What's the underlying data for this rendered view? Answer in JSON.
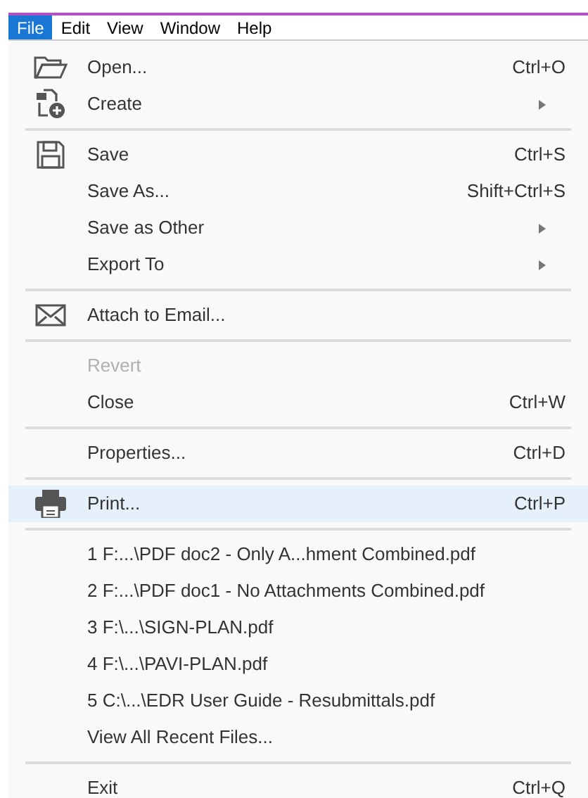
{
  "menu_bar": [
    {
      "label": "File",
      "selected": true
    },
    {
      "label": "Edit",
      "selected": false
    },
    {
      "label": "View",
      "selected": false
    },
    {
      "label": "Window",
      "selected": false
    },
    {
      "label": "Help",
      "selected": false
    }
  ],
  "menu": [
    {
      "kind": "folder",
      "label": "Open...",
      "shortcut": "Ctrl+O",
      "submenu": false,
      "disabled": false,
      "highlighted": false
    },
    {
      "kind": "create",
      "label": "Create",
      "submenu": true,
      "disabled": false,
      "highlighted": false
    },
    {
      "kind": "separator"
    },
    {
      "kind": "save",
      "label": "Save",
      "shortcut": "Ctrl+S",
      "submenu": false,
      "disabled": false,
      "highlighted": false
    },
    {
      "kind": "plain",
      "label": "Save As...",
      "shortcut": "Shift+Ctrl+S",
      "submenu": false,
      "disabled": false,
      "highlighted": false
    },
    {
      "kind": "plain",
      "label": "Save as Other",
      "submenu": true,
      "disabled": false,
      "highlighted": false
    },
    {
      "kind": "plain",
      "label": "Export To",
      "submenu": true,
      "disabled": false,
      "highlighted": false
    },
    {
      "kind": "separator"
    },
    {
      "kind": "email",
      "label": "Attach to Email...",
      "submenu": false,
      "disabled": false,
      "highlighted": false
    },
    {
      "kind": "separator"
    },
    {
      "kind": "plain",
      "label": "Revert",
      "submenu": false,
      "disabled": true,
      "highlighted": false
    },
    {
      "kind": "plain",
      "label": "Close",
      "shortcut": "Ctrl+W",
      "submenu": false,
      "disabled": false,
      "highlighted": false
    },
    {
      "kind": "separator"
    },
    {
      "kind": "plain",
      "label": "Properties...",
      "shortcut": "Ctrl+D",
      "submenu": false,
      "disabled": false,
      "highlighted": false
    },
    {
      "kind": "separator"
    },
    {
      "kind": "print",
      "label": "Print...",
      "shortcut": "Ctrl+P",
      "submenu": false,
      "disabled": false,
      "highlighted": true
    },
    {
      "kind": "separator"
    },
    {
      "kind": "plain",
      "label": "1 F:...\\PDF doc2 - Only A...hment Combined.pdf",
      "submenu": false,
      "disabled": false,
      "highlighted": false
    },
    {
      "kind": "plain",
      "label": "2 F:...\\PDF doc1 - No Attachments Combined.pdf",
      "submenu": false,
      "disabled": false,
      "highlighted": false
    },
    {
      "kind": "plain",
      "label": "3 F:\\...\\SIGN-PLAN.pdf",
      "submenu": false,
      "disabled": false,
      "highlighted": false
    },
    {
      "kind": "plain",
      "label": "4 F:\\...\\PAVI-PLAN.pdf",
      "submenu": false,
      "disabled": false,
      "highlighted": false
    },
    {
      "kind": "plain",
      "label": "5 C:\\...\\EDR User Guide - Resubmittals.pdf",
      "submenu": false,
      "disabled": false,
      "highlighted": false
    },
    {
      "kind": "plain",
      "label": "View All Recent Files...",
      "submenu": false,
      "disabled": false,
      "highlighted": false
    },
    {
      "kind": "separator"
    },
    {
      "kind": "plain",
      "label": "Exit",
      "shortcut": "Ctrl+Q",
      "submenu": false,
      "disabled": false,
      "highlighted": false
    }
  ]
}
